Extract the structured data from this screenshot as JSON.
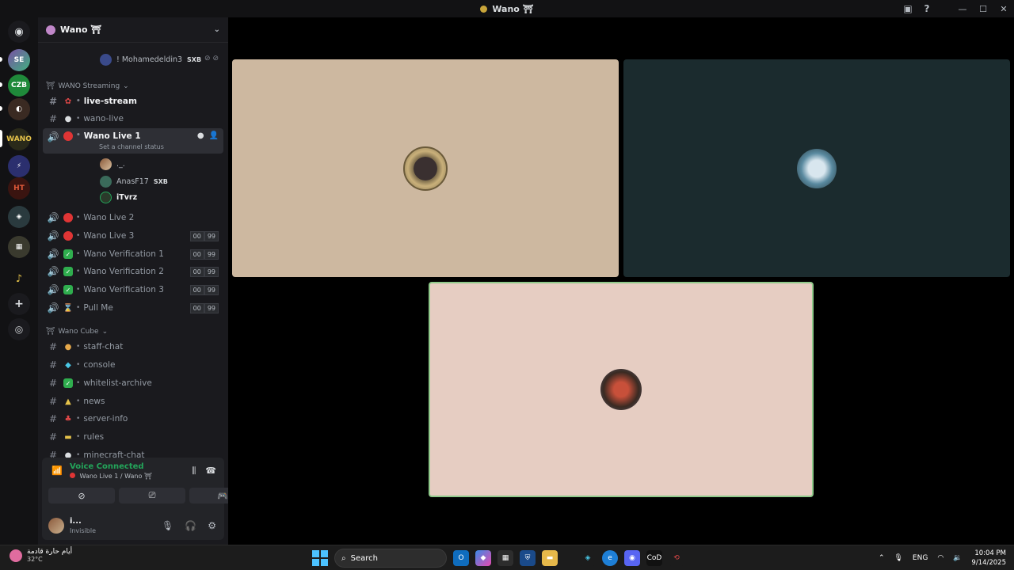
{
  "window": {
    "title": "Wano ⛩",
    "inbox_icon": "inbox-icon",
    "help_icon": "help-icon",
    "controls": [
      "—",
      "☐",
      "✕"
    ]
  },
  "server": {
    "name": "Wano ⛩"
  },
  "channels": {
    "top_member": {
      "name": "! Mohamedeldin3",
      "tag": "SXB"
    },
    "category_streaming": "WANO Streaming",
    "live_stream": "live-stream",
    "wano_live": "wano-live",
    "wano_live_1": "Wano Live 1",
    "channel_status": "Set a channel status",
    "members": [
      {
        "name": "._."
      },
      {
        "name": "AnasF17",
        "tag": "SXB"
      },
      {
        "name": "iTvrz"
      }
    ],
    "voice": [
      {
        "name": "Wano Live 2"
      },
      {
        "name": "Wano Live 3",
        "c1": "00",
        "c2": "99"
      },
      {
        "name": "Wano Verification 1",
        "c1": "00",
        "c2": "99"
      },
      {
        "name": "Wano Verification 2",
        "c1": "00",
        "c2": "99"
      },
      {
        "name": "Wano Verification 3",
        "c1": "00",
        "c2": "99"
      },
      {
        "name": "Pull Me",
        "c1": "00",
        "c2": "99"
      }
    ],
    "category_cube": "Wano Cube",
    "text": [
      {
        "name": "staff-chat"
      },
      {
        "name": "console"
      },
      {
        "name": "whitelist-archive"
      },
      {
        "name": "news"
      },
      {
        "name": "server-info"
      },
      {
        "name": "rules"
      },
      {
        "name": "minecraft-chat"
      }
    ]
  },
  "voice_panel": {
    "title": "Voice Connected",
    "subtitle": "Wano Live 1 / Wano ⛩"
  },
  "user_panel": {
    "name": "i...",
    "status": "Invisible"
  },
  "taskbar": {
    "weather_title": "أيام حارة قادمة",
    "weather_temp": "32°C",
    "search_label": "Search",
    "lang": "ENG",
    "time": "10:04 PM",
    "date": "9/14/2025"
  },
  "colors": {
    "tile1": "#cdb8a0",
    "tile2": "#1b2b2e",
    "tile3": "#e6cdc2",
    "speaking_border": "#8fc98a",
    "voice_connected": "#23a55a"
  }
}
